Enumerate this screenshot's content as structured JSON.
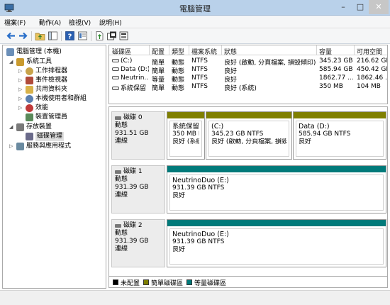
{
  "window": {
    "title": "電腦管理",
    "controls": {
      "minimize": "–",
      "maximize": "□",
      "close": "✕"
    }
  },
  "menu": [
    "檔案(F)",
    "動作(A)",
    "檢視(V)",
    "說明(H)"
  ],
  "toolbar": [
    "back-arrow-icon",
    "forward-arrow-icon",
    "up-folder-icon",
    "console-tree-icon",
    "help-icon",
    "properties-icon",
    "export-icon",
    "action-icon",
    "refresh-icon"
  ],
  "tree": [
    {
      "label": "電腦管理 (本機)",
      "expander": "",
      "icon": "computer-management-icon",
      "color": "#6b8fb8"
    },
    {
      "label": "系統工具",
      "expander": "◢",
      "icon": "system-tools-icon",
      "color": "#c99a2e"
    },
    {
      "label": "工作排程器",
      "expander": "▷",
      "icon": "task-scheduler-icon",
      "color": "#c8a34a"
    },
    {
      "label": "事件檢視器",
      "expander": "▷",
      "icon": "event-viewer-icon",
      "color": "#b04a3a"
    },
    {
      "label": "共用資料夾",
      "expander": "▷",
      "icon": "shared-folders-icon",
      "color": "#d8b24a"
    },
    {
      "label": "本機使用者和群組",
      "expander": "▷",
      "icon": "users-groups-icon",
      "color": "#5a7fb0"
    },
    {
      "label": "效能",
      "expander": "▷",
      "icon": "performance-icon",
      "color": "#c03a3a"
    },
    {
      "label": "裝置管理員",
      "expander": "",
      "icon": "device-manager-icon",
      "color": "#5a8a5a"
    },
    {
      "label": "存放裝置",
      "expander": "◢",
      "icon": "storage-icon",
      "color": "#7a7a7a"
    },
    {
      "label": "磁碟管理",
      "expander": "",
      "icon": "disk-management-icon",
      "color": "#6a6a8a"
    },
    {
      "label": "服務與應用程式",
      "expander": "▷",
      "icon": "services-apps-icon",
      "color": "#6a8aa0"
    }
  ],
  "volume_table": {
    "headers": [
      "磁碟區",
      "配置",
      "類型",
      "檔案系統",
      "狀態",
      "容量",
      "可用空間"
    ],
    "rows": [
      [
        "(C:)",
        "簡單",
        "動態",
        "NTFS",
        "良好 (啟動, 分頁檔案, 損毀傾印)",
        "345.23 GB",
        "216.62 GB"
      ],
      [
        "Data (D:)",
        "簡單",
        "動態",
        "NTFS",
        "良好",
        "585.94 GB",
        "450.42 GB"
      ],
      [
        "Neutrin...",
        "等量",
        "動態",
        "NTFS",
        "良好",
        "1862.77 ...",
        "1862.46 ..."
      ],
      [
        "系統保留",
        "簡單",
        "動態",
        "NTFS",
        "良好 (系統)",
        "350 MB",
        "104 MB"
      ]
    ]
  },
  "disks": [
    {
      "name": "磁碟 0",
      "type": "動態",
      "size": "931.51 GB",
      "status": "連線",
      "partitions": [
        {
          "title": "系統保留",
          "line2": "350 MB NTFS",
          "line3": "良好 (系統)"
        },
        {
          "title": "(C:)",
          "line2": "345.23 GB NTFS",
          "line3": "良好 (啟動, 分頁檔案, 損毀傾印)"
        },
        {
          "title": "Data  (D:)",
          "line2": "585.94 GB NTFS",
          "line3": "良好"
        }
      ]
    },
    {
      "name": "磁碟 1",
      "type": "動態",
      "size": "931.39 GB",
      "status": "連線",
      "partitions": [
        {
          "title": "NeutrinoDuo  (E:)",
          "line2": "931.39 GB NTFS",
          "line3": "良好"
        }
      ]
    },
    {
      "name": "磁碟 2",
      "type": "動態",
      "size": "931.39 GB",
      "status": "連線",
      "partitions": [
        {
          "title": "NeutrinoDuo  (E:)",
          "line2": "931.39 GB NTFS",
          "line3": "良好"
        }
      ]
    }
  ],
  "legend": [
    {
      "label": "未配置",
      "color": "#000000"
    },
    {
      "label": "簡單磁碟區",
      "color": "#7f7f00"
    },
    {
      "label": "等量磁碟區",
      "color": "#007a7a"
    }
  ]
}
